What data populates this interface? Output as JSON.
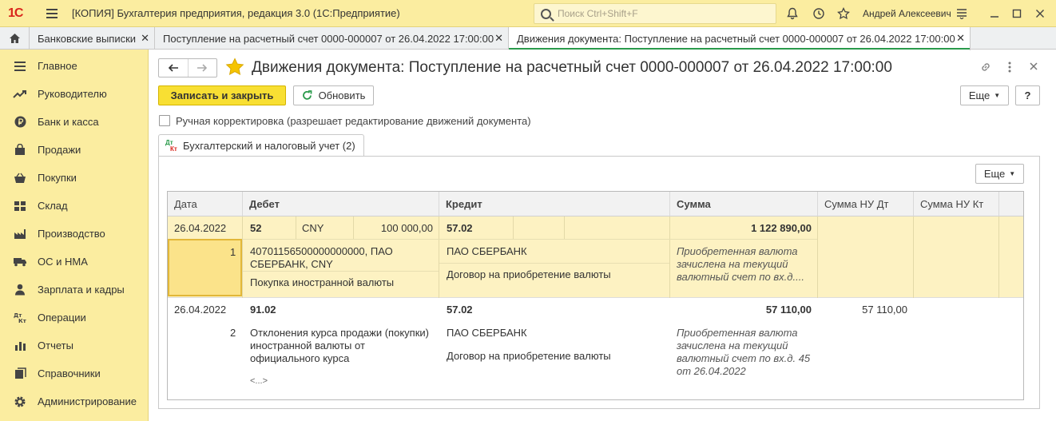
{
  "app": {
    "logo": "1С",
    "title": "[КОПИЯ] Бухгалтерия предприятия, редакция 3.0  (1С:Предприятие)",
    "search_placeholder": "Поиск Ctrl+Shift+F",
    "user": "Андрей Алексеевич"
  },
  "tabs": [
    {
      "label": "Банковские выписки"
    },
    {
      "label": "Поступление на расчетный счет 0000-000007 от 26.04.2022 17:00:00"
    },
    {
      "label": "Движения документа: Поступление на расчетный счет 0000-000007 от 26.04.2022 17:00:00"
    }
  ],
  "sidebar": {
    "items": [
      {
        "label": "Главное",
        "icon": "menu-lines-icon"
      },
      {
        "label": "Руководителю",
        "icon": "trend-icon"
      },
      {
        "label": "Банк и касса",
        "icon": "ruble-coin-icon"
      },
      {
        "label": "Продажи",
        "icon": "shopping-bag-icon"
      },
      {
        "label": "Покупки",
        "icon": "basket-icon"
      },
      {
        "label": "Склад",
        "icon": "warehouse-icon"
      },
      {
        "label": "Производство",
        "icon": "factory-icon"
      },
      {
        "label": "ОС и НМА",
        "icon": "truck-icon"
      },
      {
        "label": "Зарплата и кадры",
        "icon": "person-icon"
      },
      {
        "label": "Операции",
        "icon": "dt-kt-icon"
      },
      {
        "label": "Отчеты",
        "icon": "bar-chart-icon"
      },
      {
        "label": "Справочники",
        "icon": "books-icon"
      },
      {
        "label": "Администрирование",
        "icon": "gear-icon"
      }
    ]
  },
  "form": {
    "title": "Движения документа: Поступление на расчетный счет 0000-000007 от 26.04.2022 17:00:00",
    "save_close": "Записать и закрыть",
    "refresh": "Обновить",
    "more": "Еще",
    "help": "?",
    "manual_edit": "Ручная корректировка (разрешает редактирование движений документа)",
    "page_tab": "Бухгалтерский и налоговый учет (2)",
    "dt": "Дт",
    "kt": "Кт",
    "table_more": "Еще"
  },
  "table": {
    "columns": [
      "Дата",
      "Дебет",
      "Кредит",
      "Сумма",
      "Сумма НУ Дт",
      "Сумма НУ Кт"
    ],
    "rows": [
      {
        "date": "26.04.2022",
        "num": "1",
        "debit_account": "52",
        "debit_currency": "CNY",
        "debit_currency_amount": "100 000,00",
        "debit_sub1": "40701156500000000000, ПАО СБЕРБАНК, CNY",
        "debit_sub2": "Покупка иностранной валюты",
        "credit_account": "57.02",
        "credit_sub1": "ПАО СБЕРБАНК",
        "credit_sub2": "Договор на приобретение валюты",
        "amount": "1 122 890,00",
        "content": "Приобретенная валюта зачислена на текущий валютный счет по вх.д....",
        "nu_dt": "",
        "nu_kt": ""
      },
      {
        "date": "26.04.2022",
        "num": "2",
        "debit_account": "91.02",
        "debit_sub1": "Отклонения курса продажи (покупки) иностранной валюты от официального курса",
        "debit_sub2": "<...>",
        "credit_account": "57.02",
        "credit_sub1": "ПАО СБЕРБАНК",
        "credit_sub2": "Договор на приобретение валюты",
        "amount": "57 110,00",
        "content": "Приобретенная валюта зачислена на текущий валютный счет по вх.д. 45 от 26.04.2022",
        "nu_dt": "57 110,00",
        "nu_kt": ""
      }
    ]
  },
  "colors": {
    "sidebar_bg": "#fbeda0",
    "primary_button": "#f8df33",
    "selected_row": "#fdf2c2",
    "active_tab_underline": "#2a9a4b",
    "star": "#f5c400",
    "logo": "#d9261c"
  }
}
